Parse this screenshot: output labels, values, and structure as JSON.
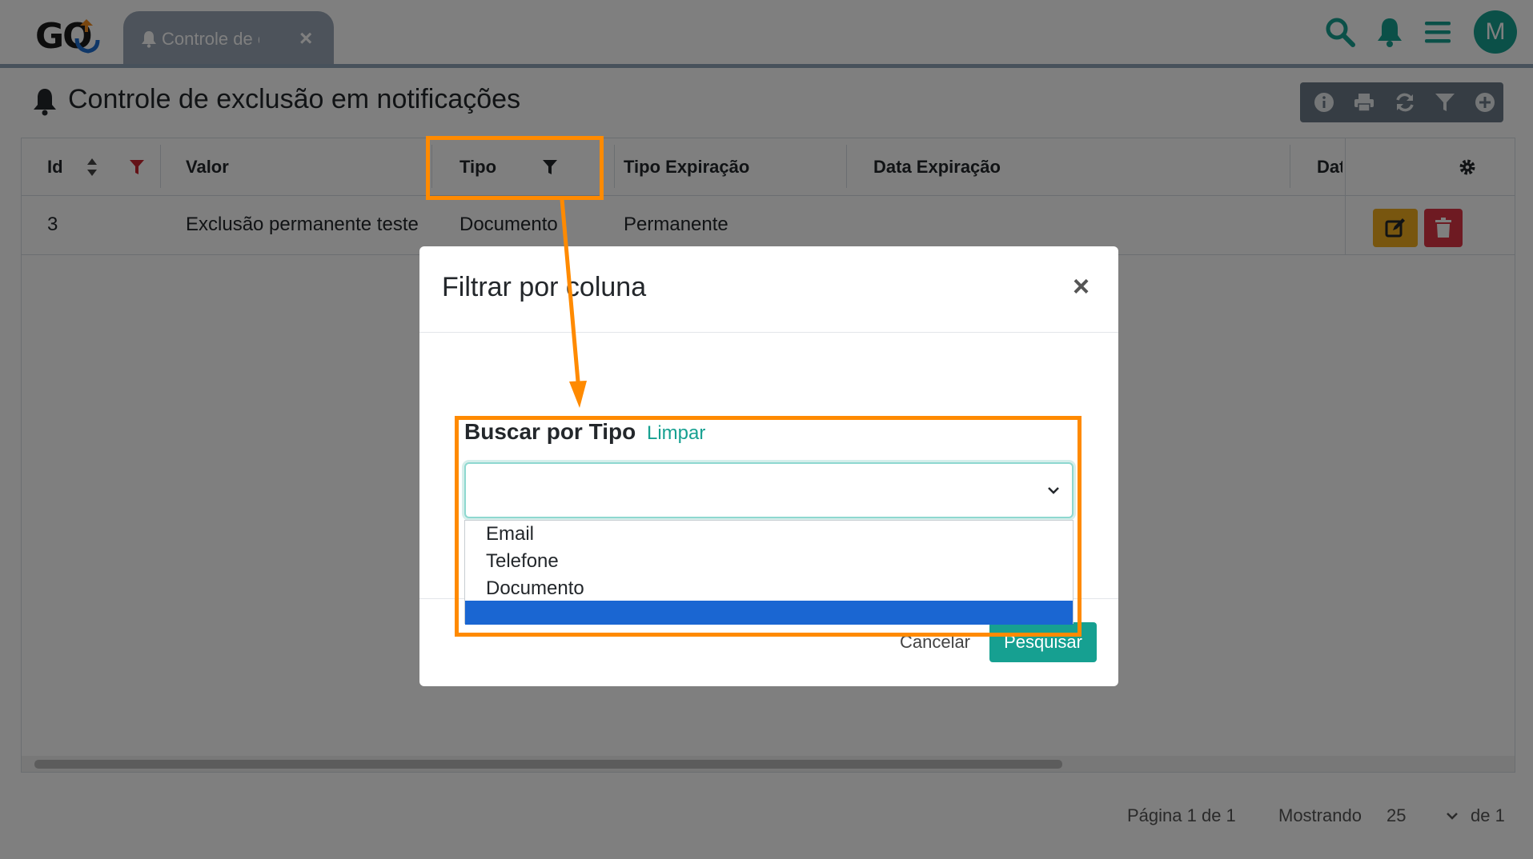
{
  "app": {
    "logo_text": "GO",
    "avatar_initial": "M"
  },
  "tab": {
    "label": "Controle de exclusão em notificações"
  },
  "page": {
    "title": "Controle de exclusão em notificações"
  },
  "toolbar": {
    "buttons": [
      "info-icon",
      "print-icon",
      "refresh-icon",
      "filter-icon",
      "add-icon"
    ]
  },
  "table": {
    "columns": [
      "Id",
      "Valor",
      "Tipo",
      "Tipo Expiração",
      "Data Expiração",
      "Dat"
    ],
    "rows": [
      {
        "id": "3",
        "valor": "Exclusão permanente teste",
        "tipo": "Documento",
        "tipo_expiracao": "Permanente",
        "data_expiracao": ""
      }
    ]
  },
  "pager": {
    "page_text": "Página 1 de 1",
    "showing_label": "Mostrando",
    "page_size": "25",
    "of_text": "de 1"
  },
  "modal": {
    "title": "Filtrar por coluna",
    "close": "×",
    "field_label": "Buscar por Tipo",
    "clear_link": "Limpar",
    "select_value": "",
    "options": [
      "Email",
      "Telefone",
      "Documento",
      ""
    ],
    "selected_index": 3,
    "cancel": "Cancelar",
    "search": "Pesquisar"
  },
  "colors": {
    "accent": "#16a091",
    "highlight": "#ff8a00",
    "edit": "#f0ad1f",
    "delete": "#dc3545",
    "selected_option": "#1a66d2"
  }
}
